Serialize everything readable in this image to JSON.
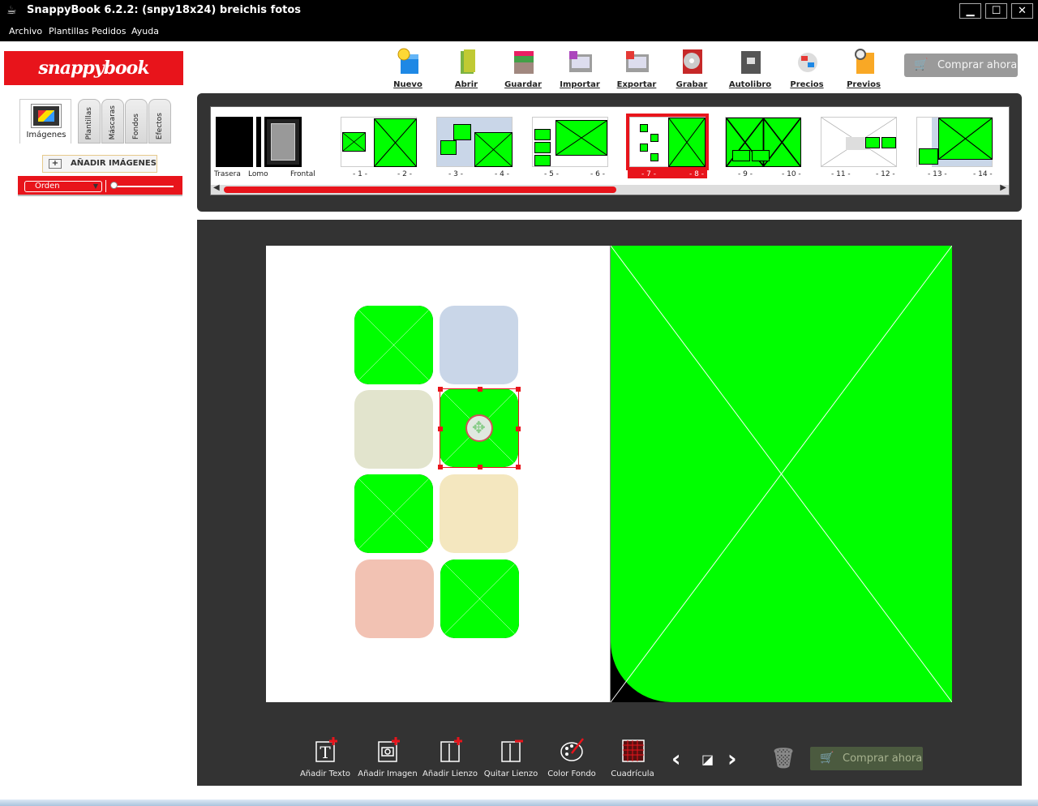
{
  "window": {
    "title": "SnappyBook 6.2.2: (snpy18x24) breichis fotos",
    "min": "▁",
    "max": "☐",
    "close": "✕"
  },
  "menu": [
    "Archivo",
    "Plantillas",
    "Pedidos",
    "Ayuda"
  ],
  "logo": "snappybook",
  "sidebar": {
    "tabs": {
      "images": "Imágenes",
      "templates": "Plantillas",
      "masks": "Máscaras",
      "backgrounds": "Fondos",
      "effects": "Efectos"
    },
    "add_images": "AÑADIR IMÁGENES",
    "sort_value": "Orden"
  },
  "toolbar": {
    "items": [
      {
        "label": "Nuevo",
        "icon": "new-icon"
      },
      {
        "label": "Abrir",
        "icon": "open-icon"
      },
      {
        "label": "Guardar",
        "icon": "save-icon"
      },
      {
        "label": "Importar",
        "icon": "import-icon"
      },
      {
        "label": "Exportar",
        "icon": "export-icon"
      },
      {
        "label": "Grabar",
        "icon": "burn-icon"
      },
      {
        "label": "Autolibro",
        "icon": "autobook-icon"
      },
      {
        "label": "Precios",
        "icon": "prices-icon"
      },
      {
        "label": "Previos",
        "icon": "preview-icon"
      }
    ],
    "buy": "Comprar ahora"
  },
  "strip": {
    "cover_labels": {
      "back": "Trasera",
      "spine": "Lomo",
      "front": "Frontal"
    },
    "page_labels": [
      "- 1 -",
      "- 2 -",
      "- 3 -",
      "- 4 -",
      "- 5 -",
      "- 6 -",
      "- 7 -",
      "- 8 -",
      "- 9 -",
      "- 10 -",
      "- 11 -",
      "- 12 -",
      "- 13 -",
      "- 14 -"
    ],
    "selected_pair": 4
  },
  "bottom": {
    "tools": [
      {
        "label": "Añadir Texto",
        "icon": "add-text-icon"
      },
      {
        "label": "Añadir Imagen",
        "icon": "add-image-icon"
      },
      {
        "label": "Añadir Lienzo",
        "icon": "add-canvas-icon"
      },
      {
        "label": "Quitar Lienzo",
        "icon": "remove-canvas-icon"
      },
      {
        "label": "Color Fondo",
        "icon": "background-color-icon"
      },
      {
        "label": "Cuadrícula",
        "icon": "grid-icon"
      }
    ],
    "buy": "Comprar ahora"
  },
  "colors": {
    "brand_red": "#e8141b",
    "placeholder_green": "#00ff00",
    "dark_panel": "#333333"
  }
}
